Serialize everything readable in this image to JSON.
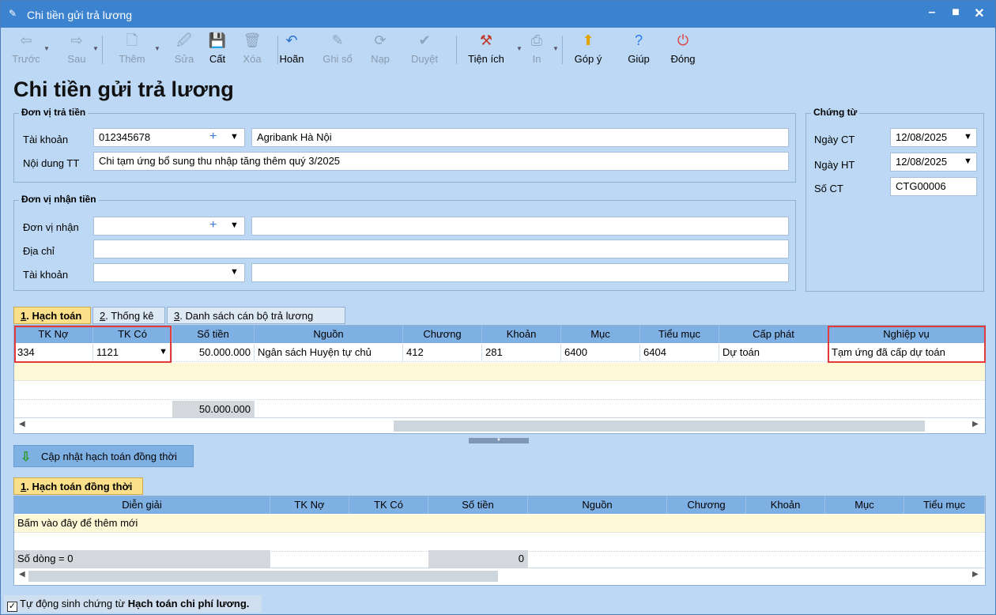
{
  "window": {
    "title": "Chi tiền gửi trả lương",
    "min": "–",
    "max": "■",
    "close": "✕"
  },
  "toolbar": [
    {
      "name": "back",
      "label": "Trước",
      "icon": "⇦",
      "disabled": true,
      "dd": true
    },
    {
      "name": "forward",
      "label": "Sau",
      "icon": "⇨",
      "disabled": true,
      "dd": true
    },
    {
      "name": "add",
      "label": "Thêm",
      "icon": "🗋",
      "disabled": true,
      "dd": true
    },
    {
      "name": "edit",
      "label": "Sửa",
      "icon": "🖉",
      "disabled": true
    },
    {
      "name": "save",
      "label": "Cất",
      "icon": "💾",
      "disabled": false
    },
    {
      "name": "delete",
      "label": "Xóa",
      "icon": "🗑",
      "disabled": true
    },
    {
      "name": "undo",
      "label": "Hoãn",
      "icon": "↶",
      "disabled": false
    },
    {
      "name": "post",
      "label": "Ghi sổ",
      "icon": "✎",
      "disabled": true
    },
    {
      "name": "load",
      "label": "Nạp",
      "icon": "⟳",
      "disabled": true
    },
    {
      "name": "approve",
      "label": "Duyệt",
      "icon": "✔",
      "disabled": true
    },
    {
      "name": "utilities",
      "label": "Tiện ích",
      "icon": "⚒",
      "disabled": false,
      "dd": true
    },
    {
      "name": "print",
      "label": "In",
      "icon": "⎙",
      "disabled": true,
      "dd": true
    },
    {
      "name": "feedback",
      "label": "Góp ý",
      "icon": "⬆",
      "disabled": false
    },
    {
      "name": "help",
      "label": "Giúp",
      "icon": "?",
      "disabled": false
    },
    {
      "name": "close",
      "label": "Đóng",
      "icon": "⏻",
      "disabled": false
    }
  ],
  "heading": "Chi tiền gửi trả lương",
  "payer": {
    "group_title": "Đơn vị trả tiền",
    "account_label": "Tài khoản",
    "account_value": "012345678",
    "bank": "Agribank Hà Nội",
    "content_label": "Nội dung TT",
    "content_value": "Chi tạm ứng bổ sung thu nhập tăng thêm quý 3/2025"
  },
  "payee": {
    "group_title": "Đơn vị nhận tiền",
    "unit_label": "Đơn vị nhận",
    "unit_value": "",
    "unit_name": "",
    "address_label": "Địa chỉ",
    "address_value": "",
    "account_label": "Tài khoản",
    "account_value": "",
    "bank": ""
  },
  "voucher": {
    "group_title": "Chứng từ",
    "date_ct_label": "Ngày CT",
    "date_ct": "12/08/2025",
    "date_ht_label": "Ngày HT",
    "date_ht": "12/08/2025",
    "no_label": "Số CT",
    "no": "CTG00006"
  },
  "tabs1": [
    {
      "key": "1",
      "label": ". Hạch toán"
    },
    {
      "key": "2",
      "label": ". Thống kê"
    },
    {
      "key": "3",
      "label": ". Danh sách cán bộ trả lương"
    }
  ],
  "grid1": {
    "headers": [
      "TK Nợ",
      "TK Có",
      "Số tiền",
      "Nguồn",
      "Chương",
      "Khoản",
      "Mục",
      "Tiểu mục",
      "Cấp phát",
      "Nghiệp vụ"
    ],
    "row": [
      "334",
      "1121",
      "50.000.000",
      "Ngân sách Huyện tự chủ",
      "412",
      "281",
      "6400",
      "6404",
      "Dự toán",
      "Tạm ứng đã cấp dự toán"
    ],
    "total": "50.000.000"
  },
  "update_button": "Cập nhật hạch toán đồng thời",
  "tab2": {
    "key": "1",
    "label": ". Hạch toán đồng thời"
  },
  "grid2": {
    "headers": [
      "Diễn giải",
      "TK Nợ",
      "TK Có",
      "Số tiền",
      "Nguồn",
      "Chương",
      "Khoản",
      "Mục",
      "Tiểu mục"
    ],
    "add_row": "Bấm vào đây để thêm mới",
    "row_count": "Số dòng = 0",
    "total": "0"
  },
  "status": {
    "checked": "✓",
    "text_a": "Tự động sinh chứng từ ",
    "text_b": "Hạch toán chi phí lương."
  }
}
